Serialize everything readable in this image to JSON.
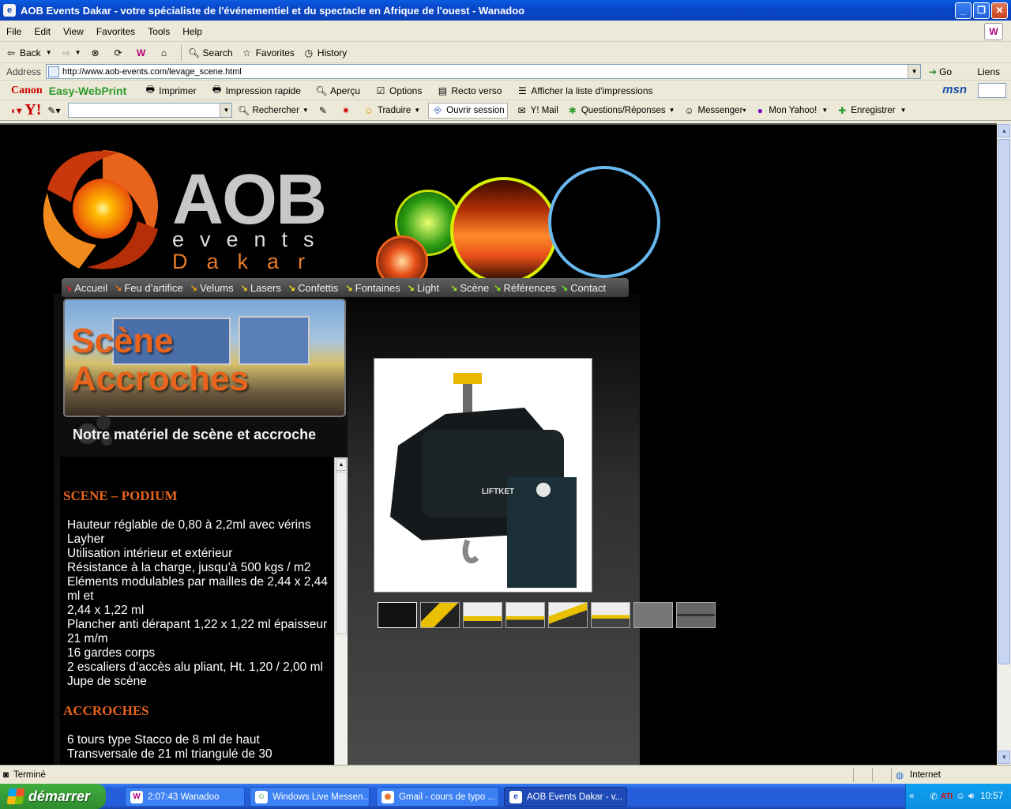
{
  "window": {
    "title": "AOB Events Dakar - votre spécialiste de l'événementiel et du spectacle en Afrique de l'ouest - Wanadoo"
  },
  "menu": [
    "File",
    "Edit",
    "View",
    "Favorites",
    "Tools",
    "Help"
  ],
  "toolbar": {
    "back": "Back",
    "search": "Search",
    "favorites": "Favorites",
    "history": "History"
  },
  "address": {
    "label": "Address",
    "url": "http://www.aob-events.com/levage_scene.html",
    "go": "Go",
    "links": "Liens"
  },
  "canon": {
    "brand": "Canon",
    "product": "Easy-WebPrint",
    "imprimer": "Imprimer",
    "rapide": "Impression rapide",
    "apercu": "Aperçu",
    "options": "Options",
    "recto": "Recto verso",
    "liste": "Afficher la liste d'impressions",
    "msn": "msn"
  },
  "yahoo": {
    "logo": "Y!",
    "rechercher": "Rechercher",
    "traduire": "Traduire",
    "ouvrir": "Ouvrir session",
    "mail": "Y! Mail",
    "qr": "Questions/Réponses",
    "messenger": "Messenger",
    "mon": "Mon Yahoo!",
    "enregistrer": "Enregistrer"
  },
  "site": {
    "logo_main": "AOB",
    "logo_sub": "events",
    "logo_city": "Dakar",
    "nav": [
      "Accueil",
      "Feu d’artifice",
      "Velums",
      "Lasers",
      "Confettis",
      "Fontaines",
      "Light",
      "Scène",
      "Références",
      "Contact"
    ],
    "banner_line1": "Scène",
    "banner_line2": "Accroches",
    "tagline": "Notre matériel de scène et accroche",
    "section1_title": "SCENE – PODIUM",
    "section1_lines": [
      "Hauteur réglable de 0,80 à 2,2ml avec vérins Layher",
      "Utilisation intérieur et extérieur",
      "Résistance à la charge, jusqu’à 500 kgs / m2",
      "Eléments modulables par mailles de 2,44 x 2,44 ml et",
      "2,44 x 1,22 ml",
      "Plancher anti dérapant 1,22 x 1,22 ml épaisseur 21 m/m",
      "16 gardes corps",
      "2 escaliers d’accès alu pliant, Ht. 1,20 / 2,00 ml",
      "Jupe de scène"
    ],
    "section2_title": "ACCROCHES",
    "section2_lines": [
      "6 tours type Stacco de 8 ml de haut",
      "Transversale de 21 ml triangulé de 30"
    ],
    "photo_brand": "LIFTKET"
  },
  "status": {
    "text": "Terminé",
    "zone": "Internet"
  },
  "taskbar": {
    "start": "démarrer",
    "tasks": [
      "2:07:43 Wanadoo",
      "Windows Live Messen...",
      "Gmail - cours de typo ...",
      "AOB Events Dakar - v..."
    ],
    "clock": "10:57"
  }
}
